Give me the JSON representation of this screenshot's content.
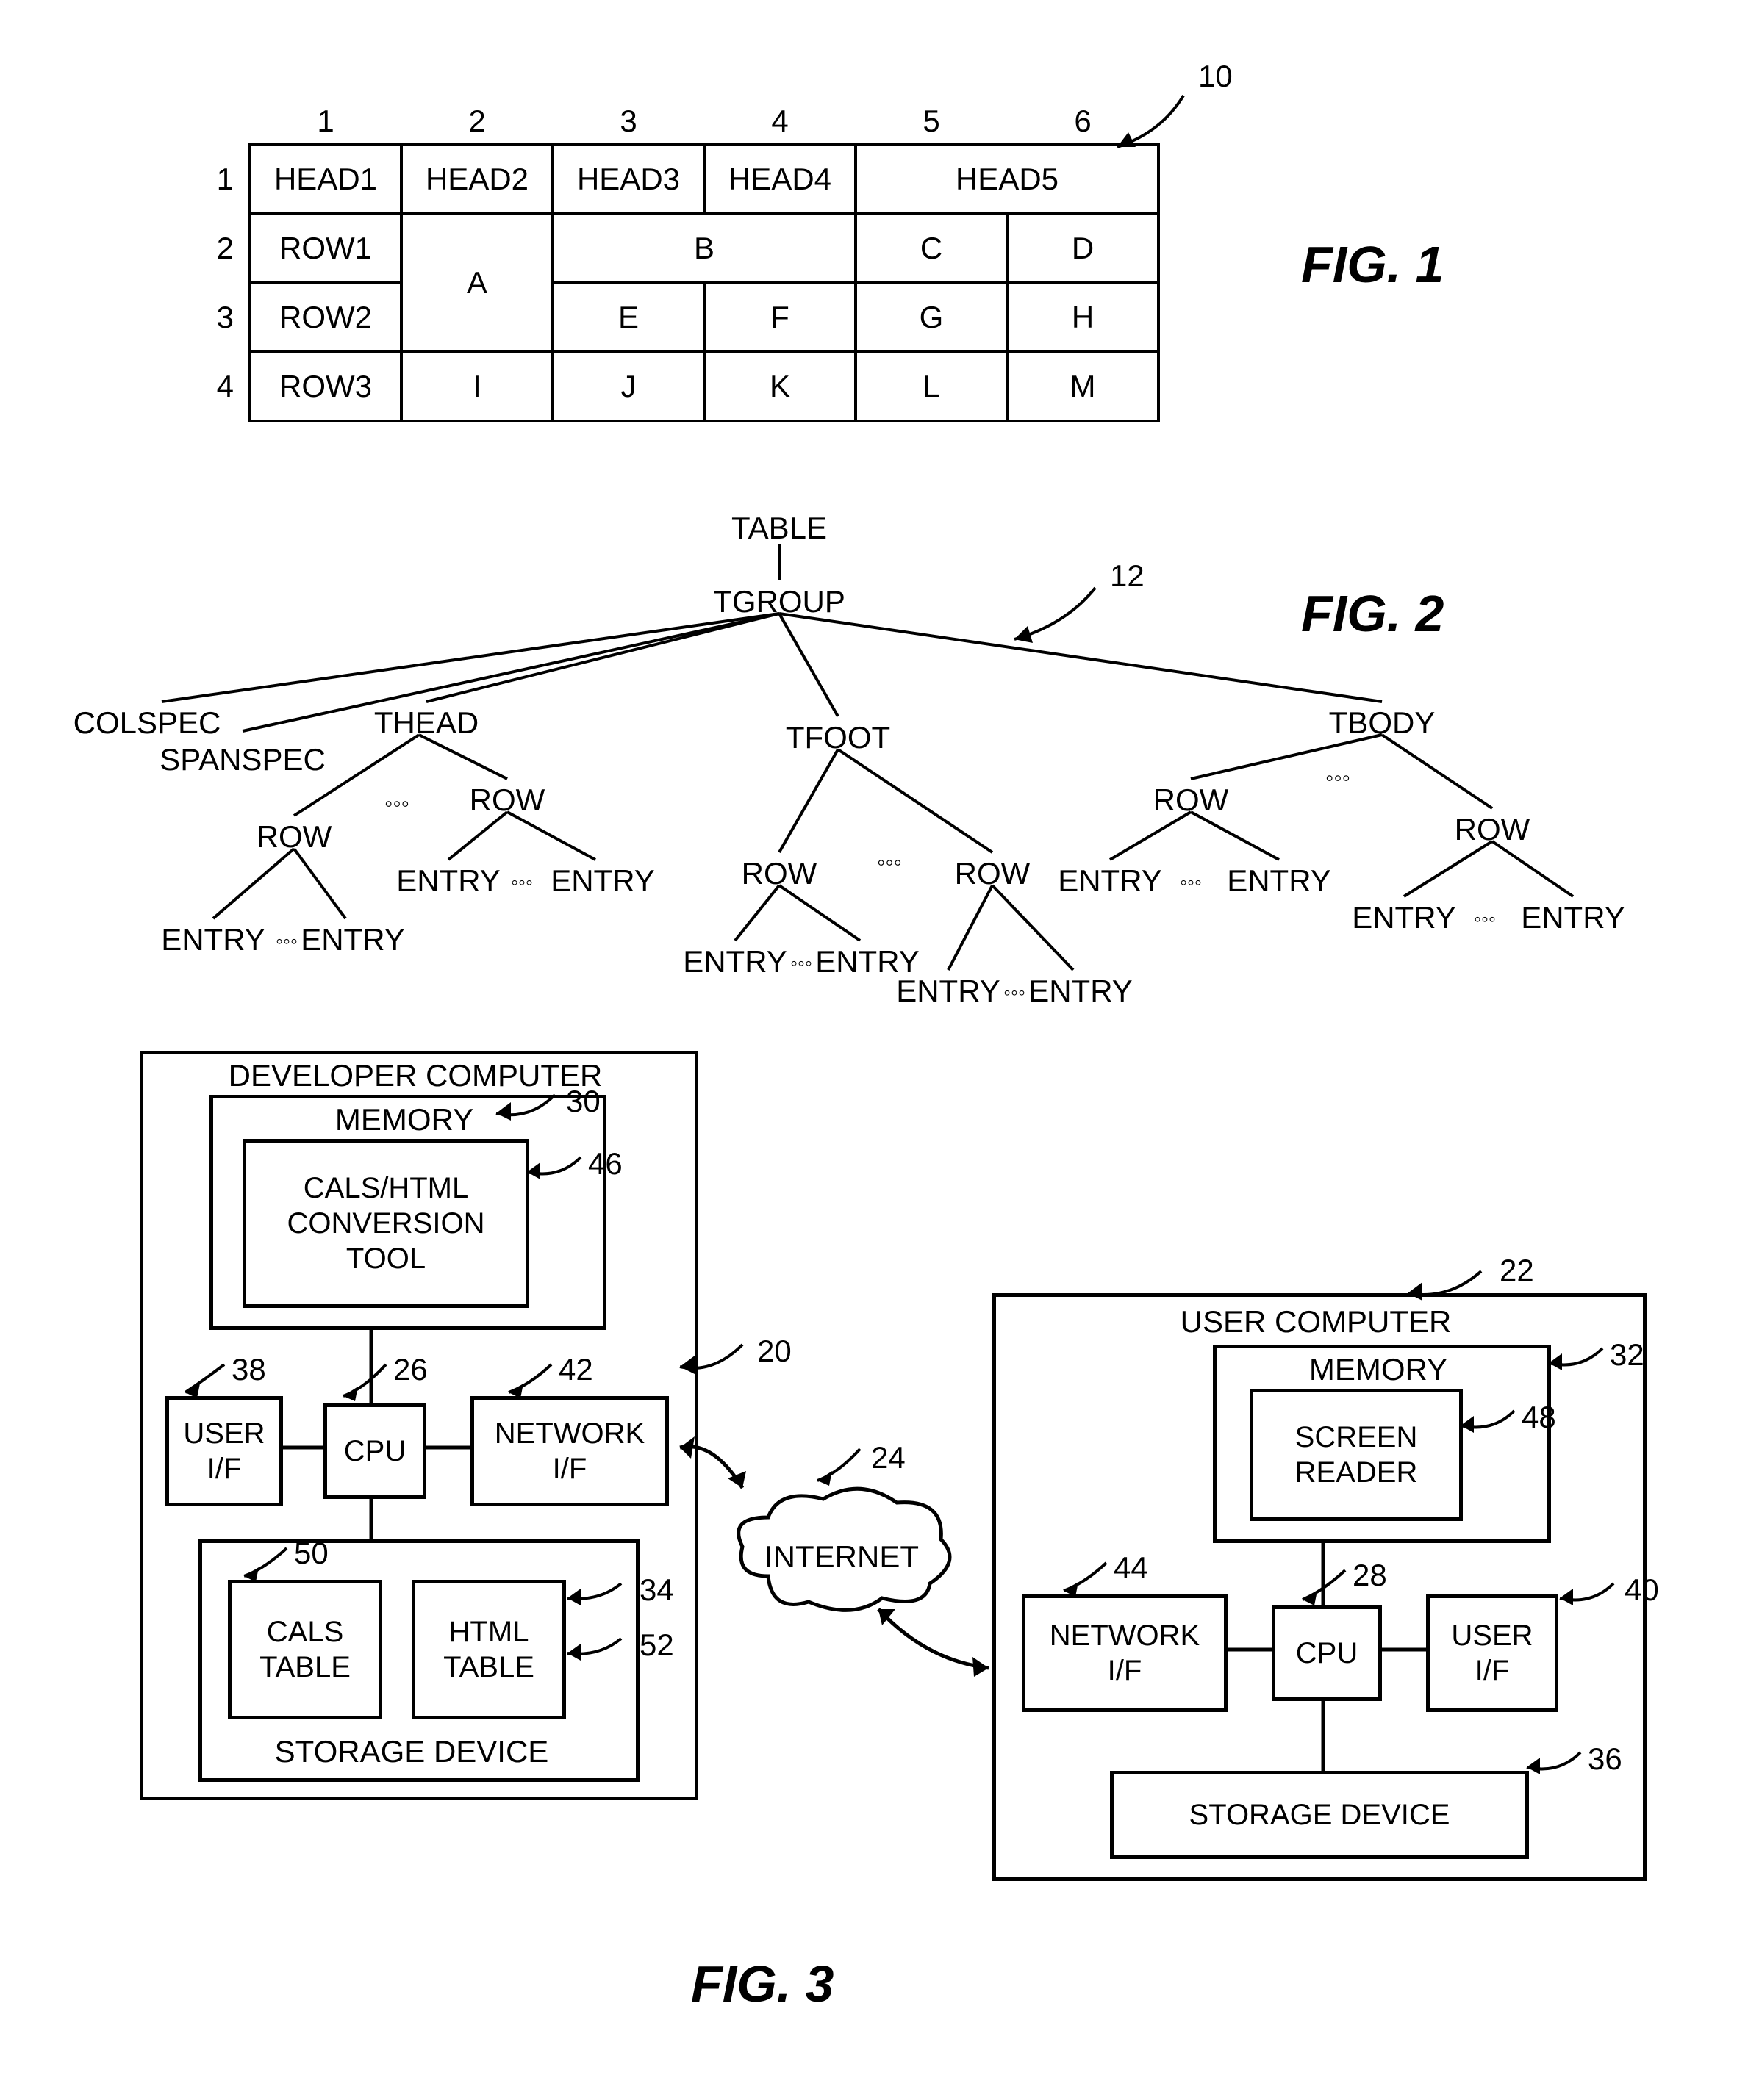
{
  "fig1": {
    "ref": "10",
    "caption": "FIG. 1",
    "cols": [
      "1",
      "2",
      "3",
      "4",
      "5",
      "6"
    ],
    "rowsnum": [
      "1",
      "2",
      "3",
      "4"
    ],
    "heads": [
      "HEAD1",
      "HEAD2",
      "HEAD3",
      "HEAD4",
      "HEAD5"
    ],
    "row2": [
      "ROW1",
      "A",
      "B",
      "C",
      "D"
    ],
    "row3": [
      "ROW2",
      "E",
      "F",
      "G",
      "H"
    ],
    "row4": [
      "ROW3",
      "I",
      "J",
      "K",
      "L",
      "M"
    ]
  },
  "fig2": {
    "ref": "12",
    "caption": "FIG. 2",
    "nodes": {
      "table": "TABLE",
      "tgroup": "TGROUP",
      "colspec": "COLSPEC",
      "spanspec": "SPANSPEC",
      "thead": "THEAD",
      "tfoot": "TFOOT",
      "tbody": "TBODY",
      "row": "ROW",
      "entry": "ENTRY",
      "dots": "◦◦◦"
    }
  },
  "fig3": {
    "caption": "FIG. 3",
    "dev": {
      "title": "DEVELOPER COMPUTER",
      "ref": "20",
      "memory": "MEMORY",
      "memory_ref": "30",
      "tool": "CALS/HTML\nCONVERSION\nTOOL",
      "tool_ref": "46",
      "userif": "USER\nI/F",
      "userif_ref": "38",
      "cpu": "CPU",
      "cpu_ref": "26",
      "netif": "NETWORK\nI/F",
      "netif_ref": "42",
      "cals": "CALS\nTABLE",
      "cals_ref": "50",
      "html": "HTML\nTABLE",
      "html_ref": "34",
      "html_ref2": "52",
      "storage": "STORAGE DEVICE"
    },
    "internet": "INTERNET",
    "internet_ref": "24",
    "user": {
      "title": "USER COMPUTER",
      "ref": "22",
      "memory": "MEMORY",
      "memory_ref": "32",
      "reader": "SCREEN\nREADER",
      "reader_ref": "48",
      "netif": "NETWORK\nI/F",
      "netif_ref": "44",
      "cpu": "CPU",
      "cpu_ref": "28",
      "userif": "USER\nI/F",
      "userif_ref": "40",
      "storage": "STORAGE DEVICE",
      "storage_ref": "36"
    }
  }
}
